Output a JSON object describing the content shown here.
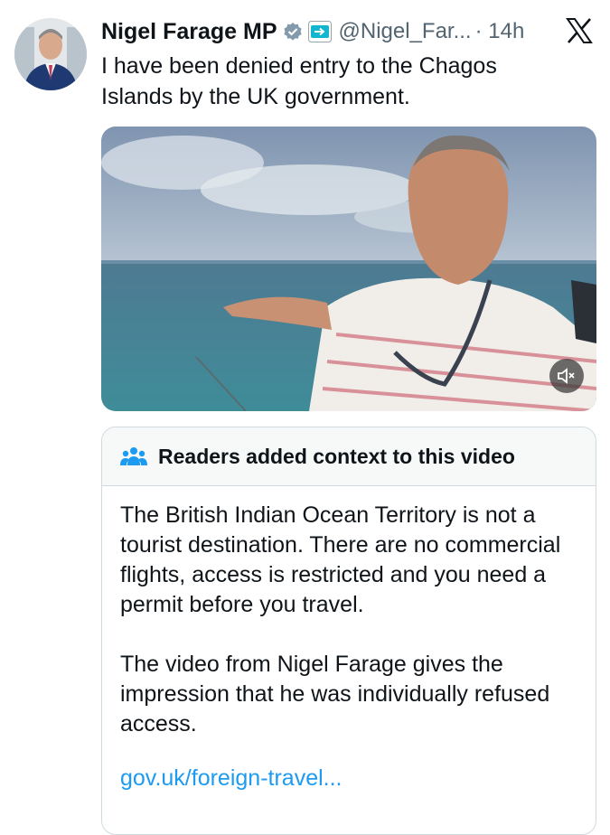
{
  "author": {
    "name": "Nigel Farage MP",
    "handle": "@Nigel_Far...",
    "time": "· 14h",
    "affiliation_badge": "REFORM UK"
  },
  "tweet": {
    "text": "I have been denied entry to the Chagos Islands by the UK government."
  },
  "media": {
    "type": "video",
    "mute_icon": "volume-muted-icon"
  },
  "note": {
    "header": "Readers added context to this video",
    "paragraph1": "The British Indian Ocean Territory is not a tourist destination. There are no commercial flights, access is restricted and you need a permit before you travel.",
    "paragraph2": "The video from Nigel Farage gives the impression that he was individually refused access.",
    "link": "gov.uk/foreign-travel..."
  },
  "colors": {
    "verified": "#829aab",
    "link": "#1d9bf0",
    "note_header_bg": "#f7f9f9",
    "text_secondary": "#536471"
  }
}
